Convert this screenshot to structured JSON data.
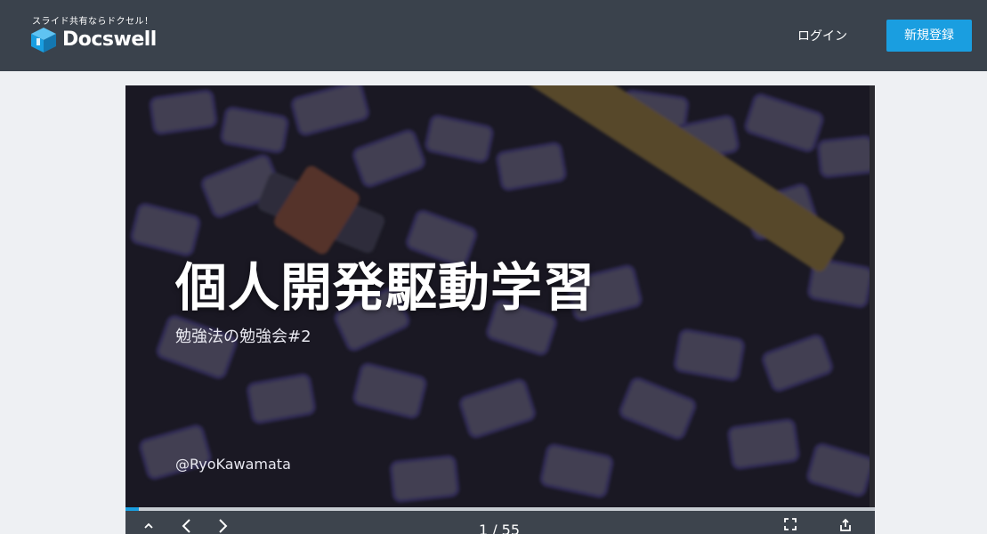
{
  "header": {
    "tagline": "スライド共有ならドクセル！",
    "brand": "Docswell",
    "login_label": "ログイン",
    "signup_label": "新規登録"
  },
  "slide": {
    "title": "個人開発駆動学習",
    "subtitle": "勉強法の勉強会#2",
    "author": "@RyoKawamata"
  },
  "viewer": {
    "current_page": 1,
    "total_pages": 55,
    "page_counter": "1 / 55",
    "progress_fraction": 0.018
  },
  "colors": {
    "header_bg": "#3a424c",
    "accent": "#1a9ee0",
    "page_bg": "#eef0f3"
  },
  "icons": {
    "collapse": "chevron-up-icon",
    "prev": "chevron-left-icon",
    "next": "chevron-right-icon",
    "fullscreen": "fullscreen-icon",
    "share": "share-icon",
    "logo": "cube-logo-icon"
  }
}
